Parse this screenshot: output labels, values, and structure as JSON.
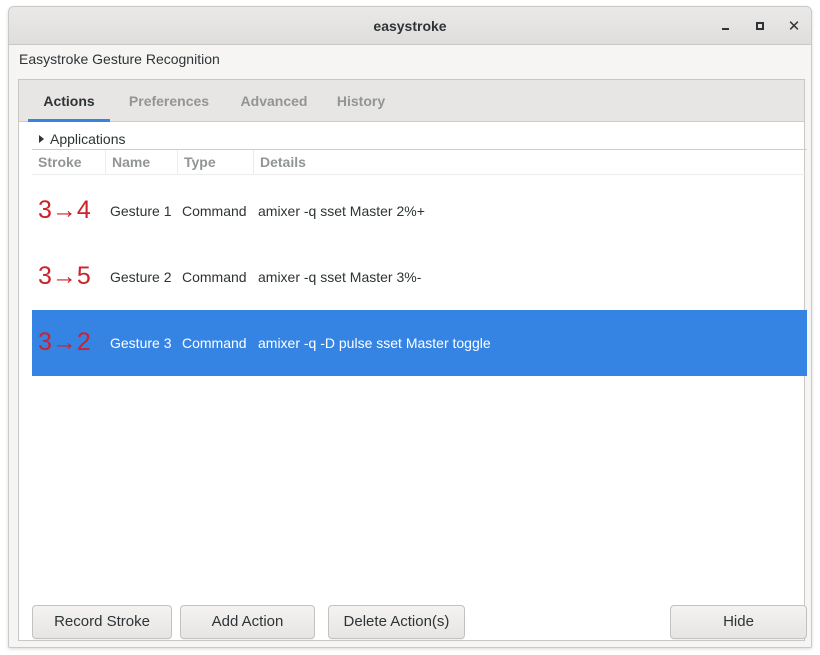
{
  "window": {
    "title": "easystroke",
    "controls": {
      "minimize_icon": "minimize-icon",
      "maximize_icon": "maximize-icon",
      "close_icon": "close-icon",
      "close_glyph": "✕"
    }
  },
  "header": {
    "label": "Easystroke Gesture Recognition"
  },
  "tabs": [
    {
      "label": "Actions",
      "active": true
    },
    {
      "label": "Preferences",
      "active": false
    },
    {
      "label": "Advanced",
      "active": false
    },
    {
      "label": "History",
      "active": false
    }
  ],
  "applications": {
    "label": "Applications",
    "expander_icon": "triangle-right-icon"
  },
  "table": {
    "columns": [
      "Stroke",
      "Name",
      "Type",
      "Details"
    ],
    "rows": [
      {
        "stroke": "3→4",
        "name": "Gesture 1",
        "type": "Command",
        "details": "amixer -q sset Master 2%+",
        "selected": false
      },
      {
        "stroke": "3→5",
        "name": "Gesture 2",
        "type": "Command",
        "details": "amixer -q sset Master 3%-",
        "selected": false
      },
      {
        "stroke": "3→2",
        "name": "Gesture 3",
        "type": "Command",
        "details": "amixer -q -D pulse sset Master toggle",
        "selected": true
      }
    ]
  },
  "buttons": {
    "record_stroke": "Record Stroke",
    "add_action": "Add Action",
    "delete_actions": "Delete Action(s)",
    "hide": "Hide"
  },
  "colors": {
    "accent": "#3584e4",
    "stroke_glyph": "#d0202a",
    "muted_text": "#929595"
  }
}
